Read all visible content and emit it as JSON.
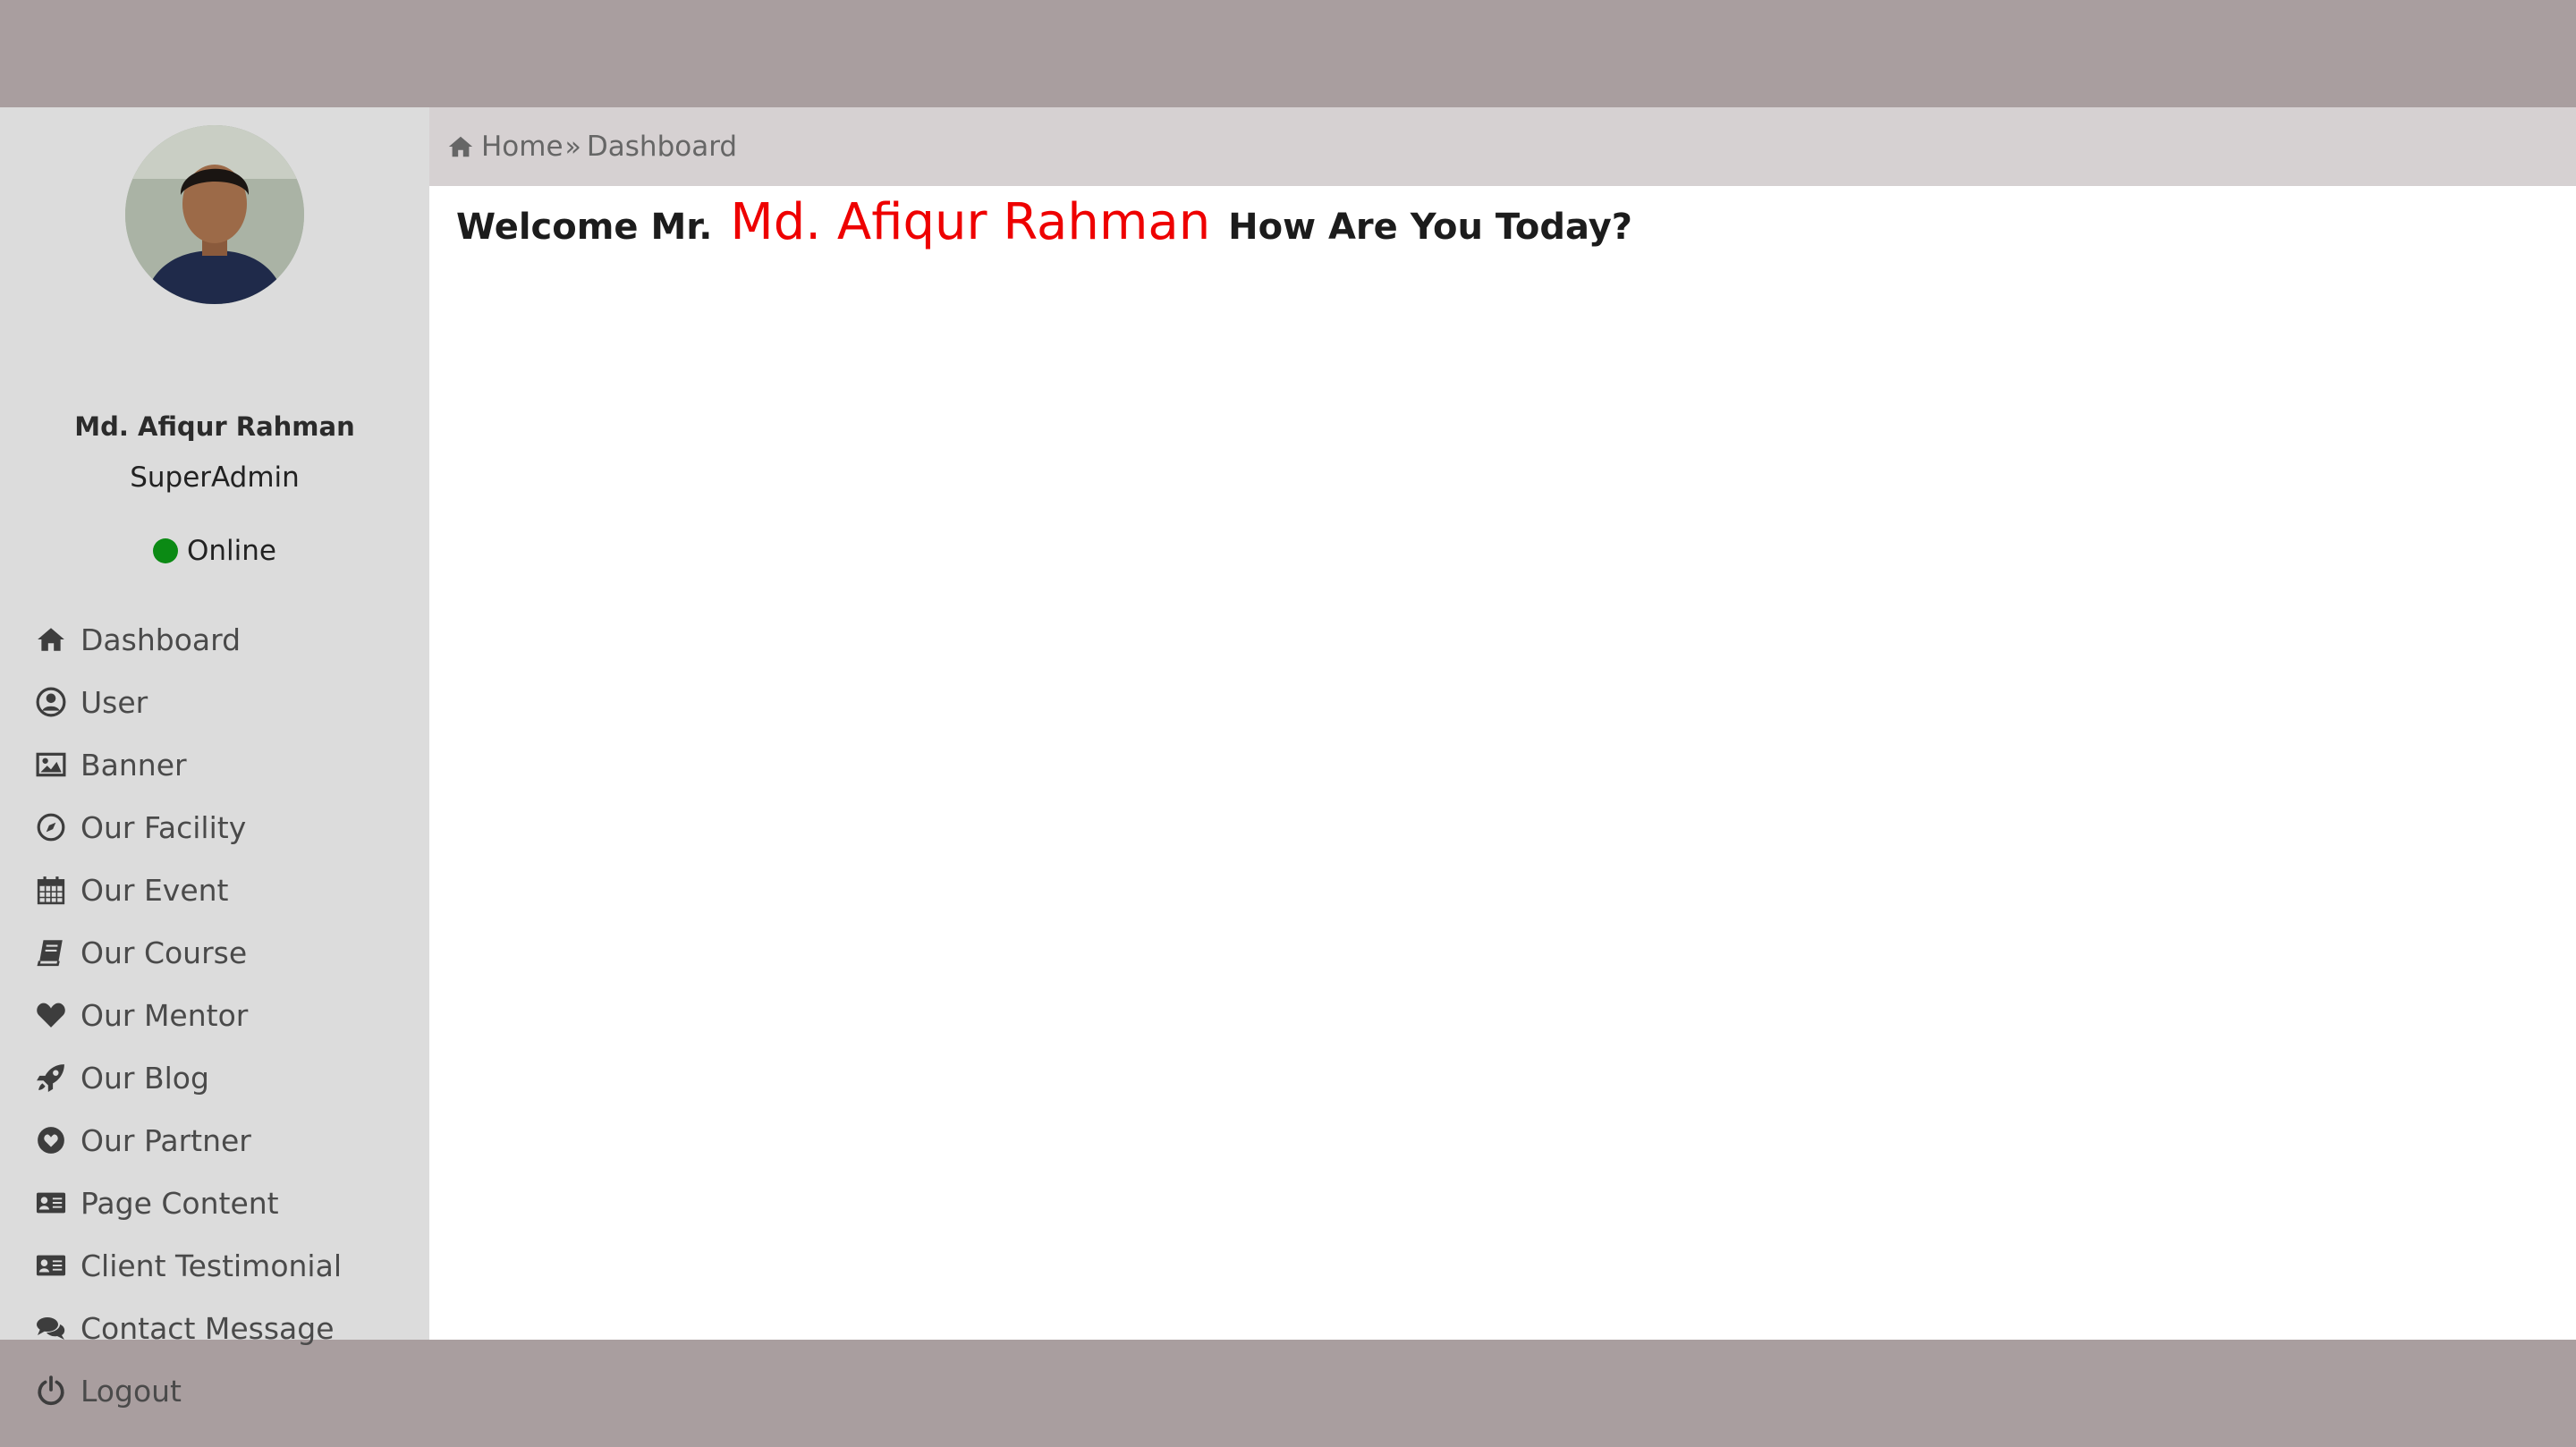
{
  "profile": {
    "name": "Md. Afiqur Rahman",
    "role": "SuperAdmin",
    "status": "Online"
  },
  "sidebar": {
    "items": [
      {
        "label": "Dashboard",
        "icon": "home-icon"
      },
      {
        "label": "User",
        "icon": "user-circle-icon"
      },
      {
        "label": "Banner",
        "icon": "image-icon"
      },
      {
        "label": "Our Facility",
        "icon": "compass-icon"
      },
      {
        "label": "Our Event",
        "icon": "calendar-icon"
      },
      {
        "label": "Our Course",
        "icon": "book-icon"
      },
      {
        "label": "Our Mentor",
        "icon": "heart-icon"
      },
      {
        "label": "Our Blog",
        "icon": "rocket-icon"
      },
      {
        "label": "Our Partner",
        "icon": "heart-circle-icon"
      },
      {
        "label": "Page Content",
        "icon": "id-card-icon"
      },
      {
        "label": "Client Testimonial",
        "icon": "id-card-icon"
      },
      {
        "label": "Contact Message",
        "icon": "comments-icon"
      },
      {
        "label": "Logout",
        "icon": "power-icon"
      }
    ]
  },
  "breadcrumb": {
    "home": "Home",
    "separator": "»",
    "current": "Dashboard"
  },
  "welcome": {
    "prefix": "Welcome Mr.",
    "name": "Md. Afiqur Rahman",
    "suffix": "How Are You Today?"
  },
  "colors": {
    "sidebar_bg": "#dcdcdc",
    "breadcrumb_bg": "#d6d1d2",
    "outer_bg": "#a99e9f",
    "online": "#0b8a14",
    "name_highlight": "#ee0000"
  }
}
